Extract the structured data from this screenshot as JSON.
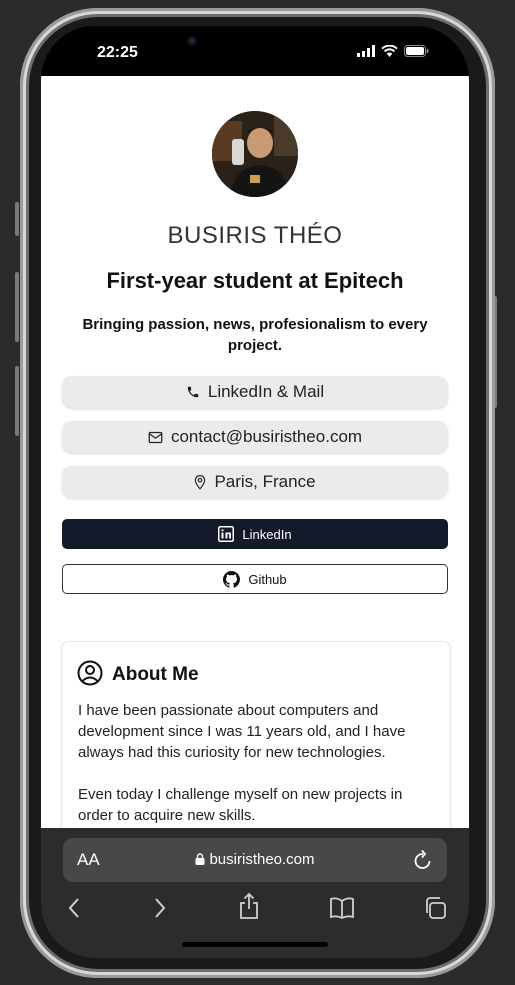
{
  "status_bar": {
    "time": "22:25"
  },
  "profile": {
    "name": "BUSIRIS THÉO",
    "headline": "First-year student at Epitech",
    "tagline": "Bringing passion, news, profesionalism to every project."
  },
  "contacts": [
    {
      "icon": "phone-icon",
      "label": "LinkedIn & Mail"
    },
    {
      "icon": "mail-icon",
      "label": "contact@busiristheo.com"
    },
    {
      "icon": "location-pin-icon",
      "label": "Paris, France"
    }
  ],
  "buttons": {
    "linkedin": "LinkedIn",
    "github": "Github"
  },
  "about": {
    "title": "About Me",
    "paragraph1": "I have been passionate about computers and development since I was 11 years old, and I have always had this curiosity for new technologies.",
    "paragraph2": "Even today I challenge myself on new projects in order to acquire new skills."
  },
  "browser": {
    "aa_label": "AA",
    "url": "busiristheo.com"
  },
  "colors": {
    "linkedin_button": "#141a2a",
    "toolbar": "#2c2c2e"
  }
}
